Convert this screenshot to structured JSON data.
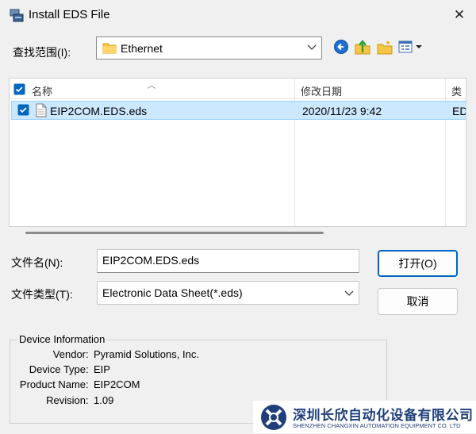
{
  "window": {
    "title": "Install EDS File",
    "close_glyph": "✕"
  },
  "look_in": {
    "label": "查找范围(I):",
    "value": "Ethernet"
  },
  "toolbar": {
    "icons": [
      "back-icon",
      "up-folder-icon",
      "new-folder-icon",
      "view-menu-icon"
    ]
  },
  "file_list": {
    "columns": {
      "name": "名称",
      "date": "修改日期",
      "type": "类"
    },
    "rows": [
      {
        "name": "EIP2COM.EDS.eds",
        "date": "2020/11/23 9:42",
        "type": "ED"
      }
    ]
  },
  "file_name": {
    "label": "文件名(N):",
    "value": "EIP2COM.EDS.eds"
  },
  "file_type": {
    "label": "文件类型(T):",
    "value": "Electronic Data Sheet(*.eds)"
  },
  "buttons": {
    "open": "打开(O)",
    "cancel": "取消"
  },
  "device_info": {
    "legend": "Device Information",
    "fields": [
      {
        "label": "Vendor",
        "value": "Pyramid Solutions, Inc."
      },
      {
        "label": "Device Type",
        "value": "EIP"
      },
      {
        "label": "Product Name",
        "value": "EIP2COM"
      },
      {
        "label": "Revision",
        "value": "1.09"
      }
    ]
  },
  "watermark": {
    "company_cn": "深圳长欣自动化设备有限公司",
    "company_en": "SHENZHEN CHANGXIN AUTOMATION EQUIPMENT CO. LTD"
  },
  "colors": {
    "accent": "#0067c0",
    "selection": "#cce8ff",
    "brand": "#1f3f7a"
  }
}
